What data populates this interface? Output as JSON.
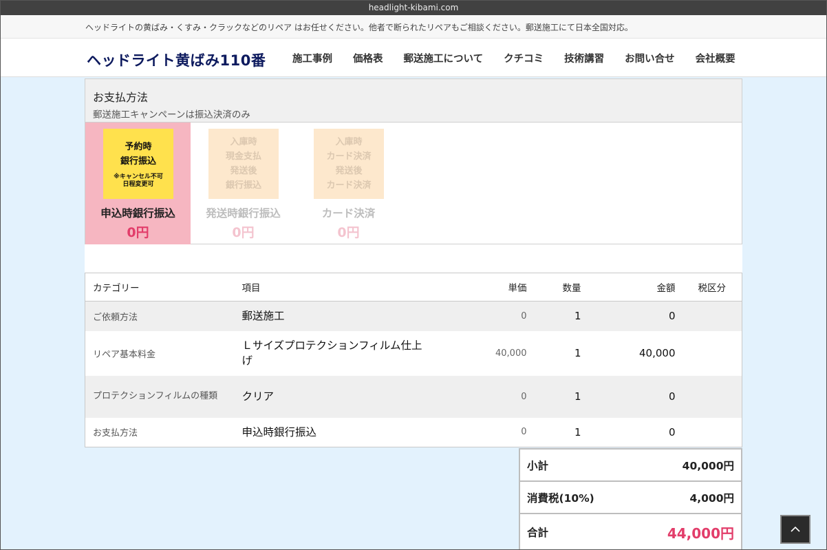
{
  "browser": {
    "url": "headlight-kibami.com"
  },
  "notice": {
    "text": "ヘッドライトの黄ばみ・くすみ・クラックなどのリペア はお任せください。他者で断られたリペアもご相談ください。郵送施工にて日本全国対応。"
  },
  "header": {
    "logo": "ヘッドライト黄ばみ110番",
    "nav": [
      "施工事例",
      "価格表",
      "郵送施工について",
      "クチコミ",
      "技術講習",
      "お問い合せ",
      "会社概要"
    ]
  },
  "payment": {
    "title": "お支払方法",
    "subtitle": "郵送施工キャンペーンは振込決済のみ",
    "options": [
      {
        "image_lines": [
          "予約時",
          "銀行振込"
        ],
        "image_note": [
          "※キャンセル不可",
          "日程変更可"
        ],
        "name": "申込時銀行振込",
        "price": "0円",
        "selected": true
      },
      {
        "image_lines": [
          "入庫時",
          "現金支払",
          "発送後",
          "銀行振込"
        ],
        "name": "発送時銀行振込",
        "price": "0円",
        "selected": false
      },
      {
        "image_lines": [
          "入庫時",
          "カード決済",
          "発送後",
          "カード決済"
        ],
        "name": "カード決済",
        "price": "0円",
        "selected": false
      }
    ]
  },
  "order": {
    "headers": {
      "category": "カテゴリー",
      "item": "項目",
      "unit": "単価",
      "qty": "数量",
      "amount": "金額",
      "tax": "税区分"
    },
    "rows": [
      {
        "category": "ご依頼方法",
        "item": "郵送施工",
        "unit": "0",
        "qty": "1",
        "amount": "0",
        "tax": ""
      },
      {
        "category": "リペア基本料金",
        "item": "Ｌサイズプロテクションフィルム仕上げ",
        "unit": "40,000",
        "qty": "1",
        "amount": "40,000",
        "tax": ""
      },
      {
        "category": "プロテクションフィルムの種類",
        "item": "クリア",
        "unit": "0",
        "qty": "1",
        "amount": "0",
        "tax": ""
      },
      {
        "category": "お支払方法",
        "item": "申込時銀行振込",
        "unit": "0",
        "qty": "1",
        "amount": "0",
        "tax": ""
      }
    ]
  },
  "totals": {
    "subtotal_label": "小計",
    "subtotal": "40,000円",
    "tax_label": "消費税(10%)",
    "tax": "4,000円",
    "total_label": "合計",
    "total": "44,000円"
  },
  "icons": {
    "scroll_top": "chevron-up-icon"
  },
  "colors": {
    "accent_pink": "#e23d6a",
    "selected_bg": "#f6b6c1",
    "logo_navy": "#0d1a5e",
    "page_bg": "#e3f2fd"
  }
}
